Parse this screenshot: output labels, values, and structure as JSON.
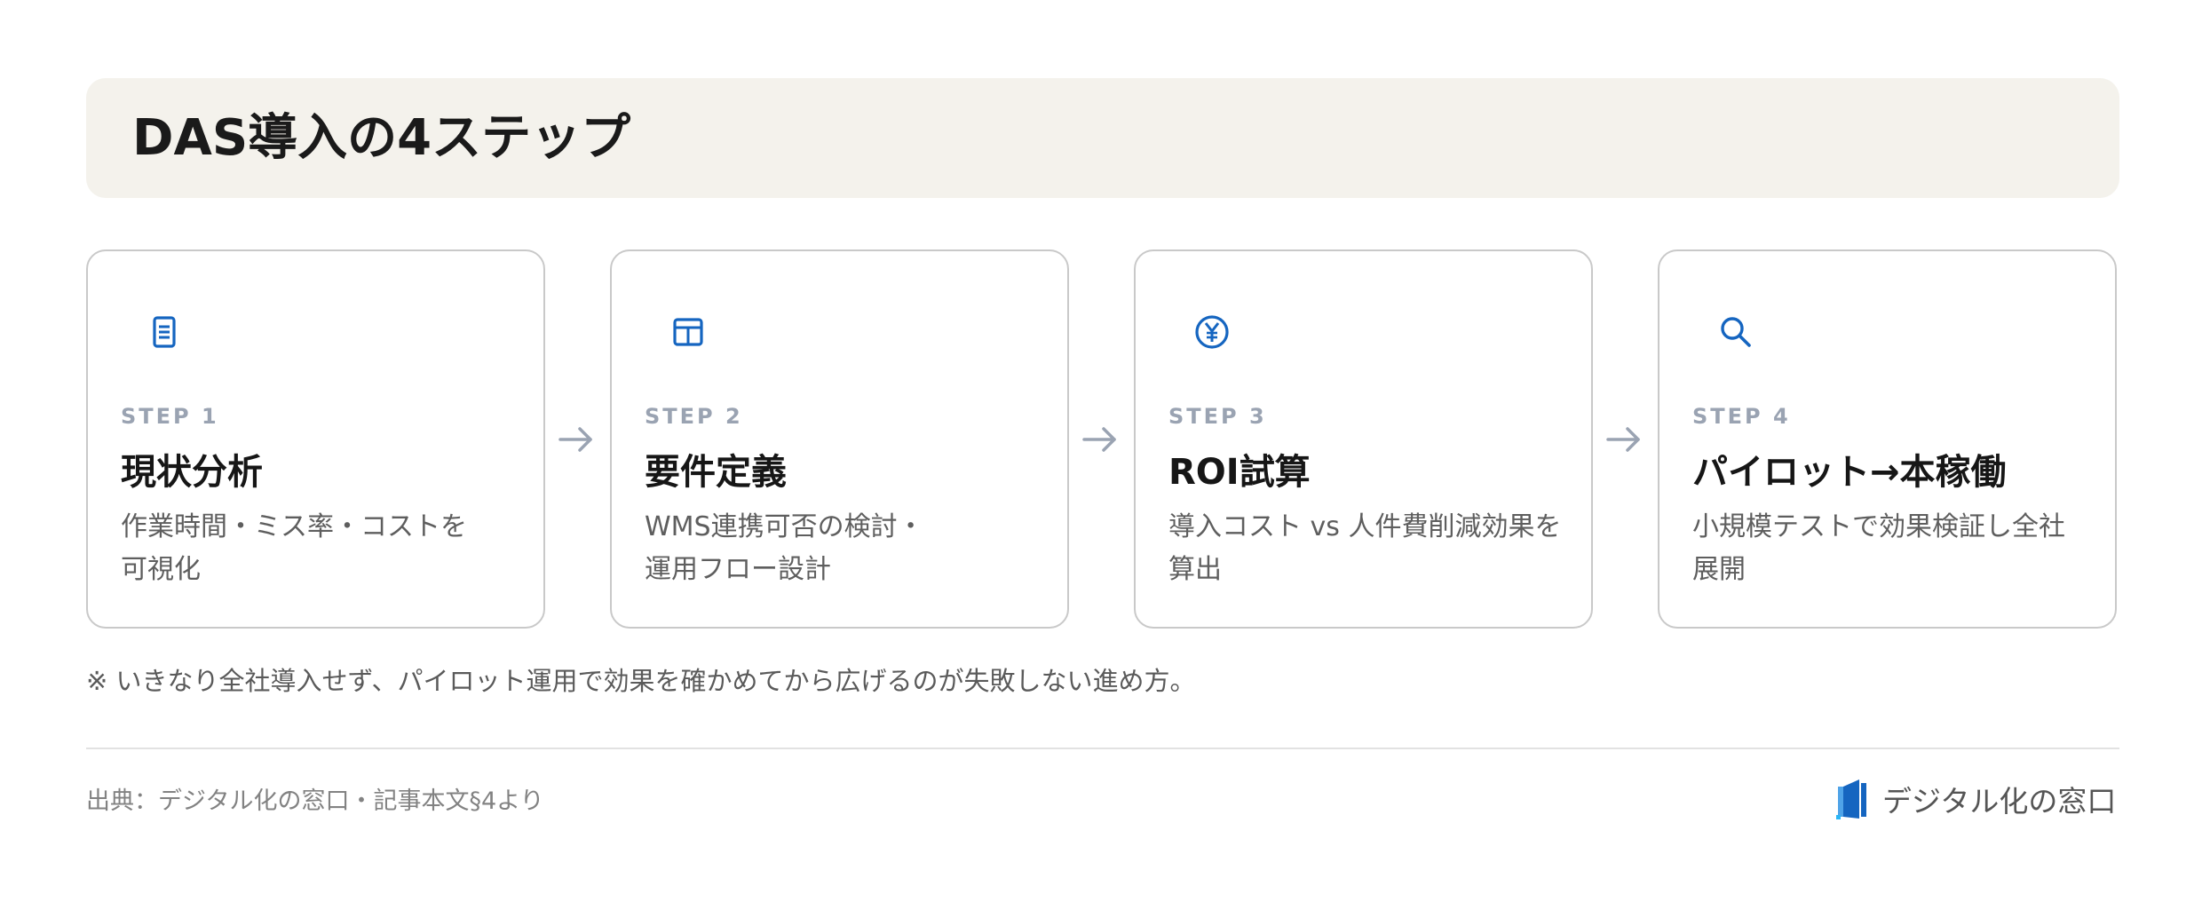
{
  "title": "DAS導入の4ステップ",
  "steps": [
    {
      "step": "STEP 1",
      "title": "現状分析",
      "desc": [
        "作業時間・ミス率・コストを",
        "可視化"
      ],
      "icon": "document-icon"
    },
    {
      "step": "STEP 2",
      "title": "要件定義",
      "desc": [
        "WMS連携可否の検討・",
        "運用フロー設計"
      ],
      "icon": "table-icon"
    },
    {
      "step": "STEP 3",
      "title": "ROI試算",
      "desc": [
        "導入コスト vs 人件費削減効果を",
        "算出"
      ],
      "icon": "yen-icon"
    },
    {
      "step": "STEP 4",
      "title": "パイロット→本稼働",
      "desc": [
        "小規模テストで効果検証し全社",
        "展開"
      ],
      "icon": "search-icon"
    }
  ],
  "note": "※ いきなり全社導入せず、パイロット運用で効果を確かめてから広げるのが失敗しない進め方。",
  "source": "出典：デジタル化の窓口・記事本文§4より",
  "brand": "デジタル化の窓口",
  "colors": {
    "accent": "#1565c0",
    "step_label": "#9aa3b2",
    "arrow": "#9aa3b2",
    "title_bg": "#f4f2ec"
  }
}
